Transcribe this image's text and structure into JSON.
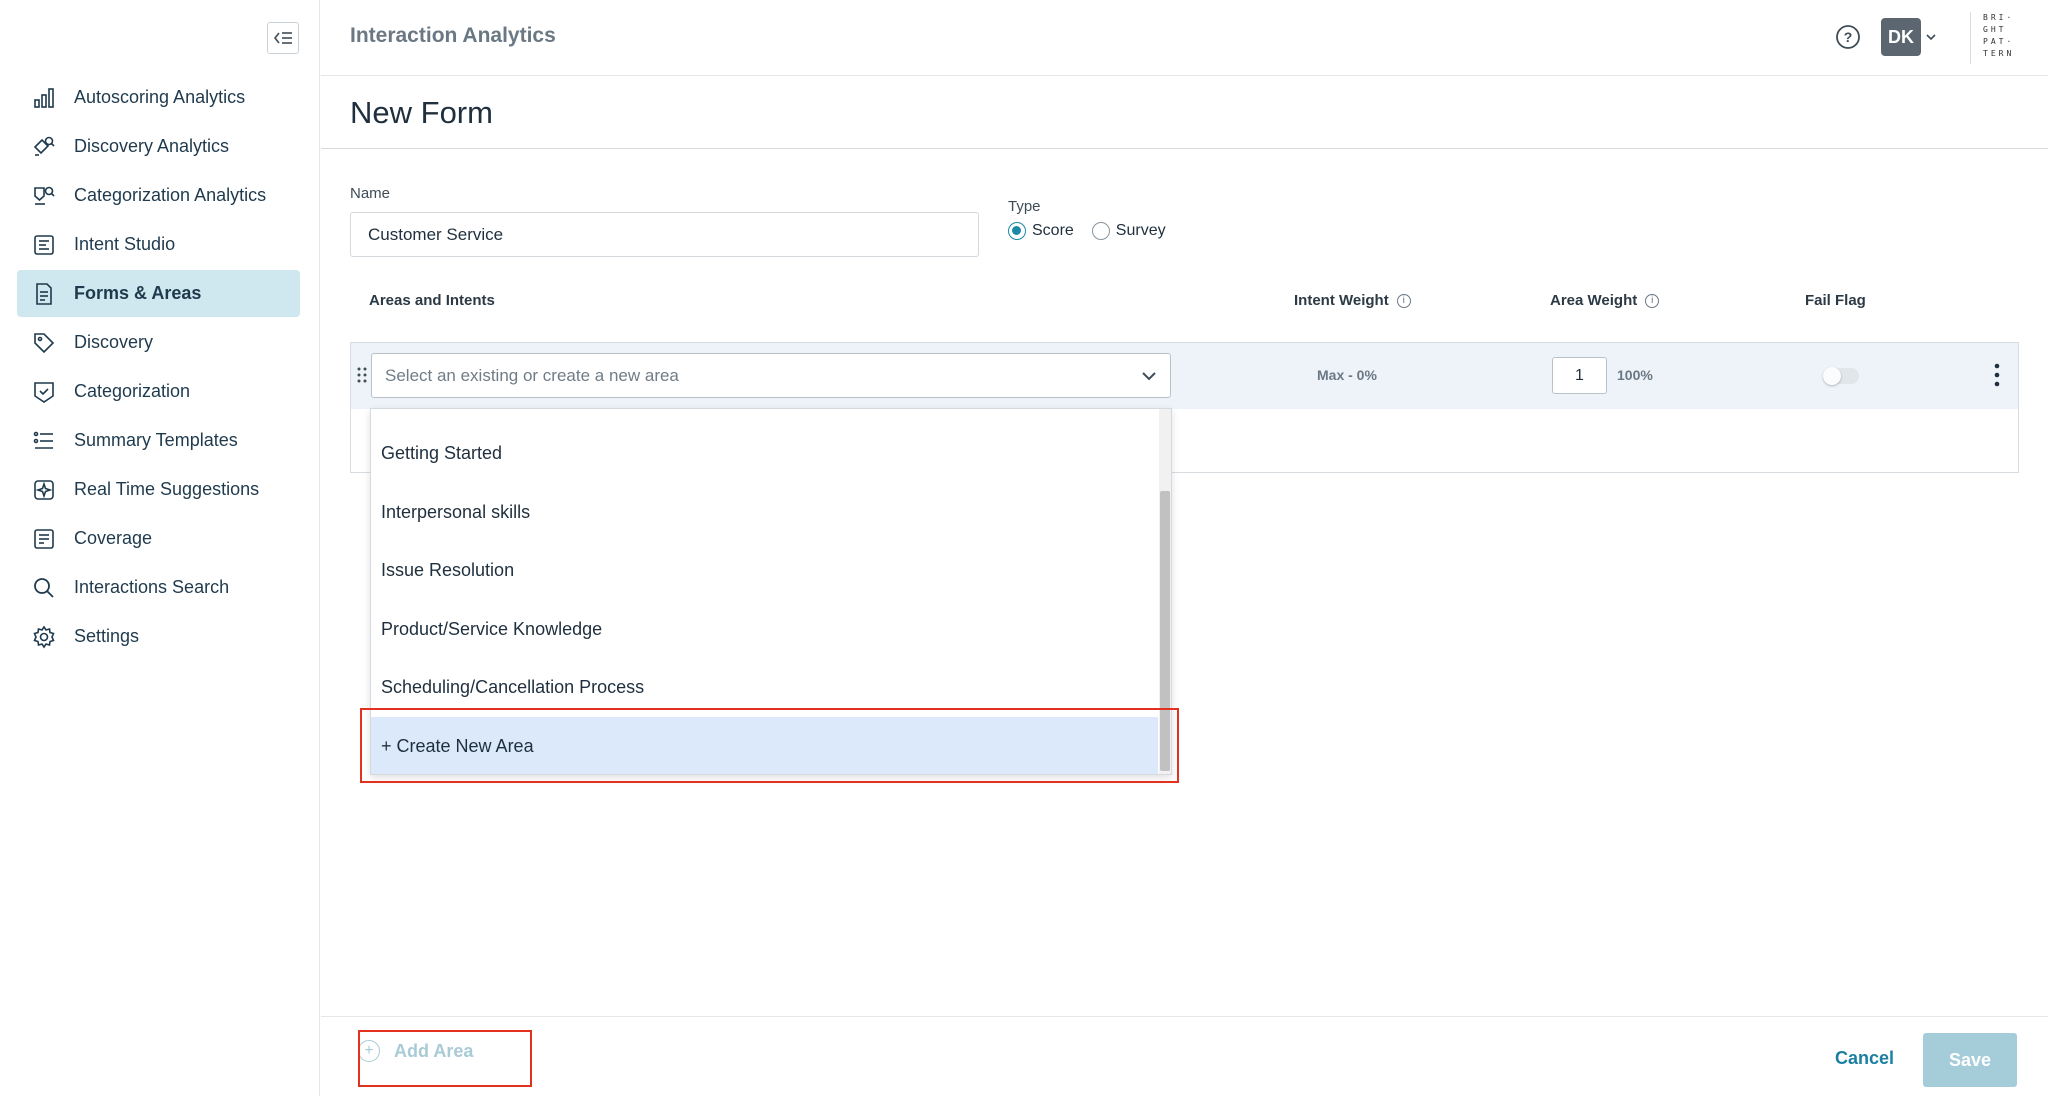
{
  "sidebar": {
    "collapse_icon": "collapse-sidebar-icon",
    "items": [
      {
        "label": "Autoscoring Analytics",
        "icon": "bar-chart-icon",
        "active": false
      },
      {
        "label": "Discovery Analytics",
        "icon": "discovery-analytics-icon",
        "active": false
      },
      {
        "label": "Categorization Analytics",
        "icon": "categorization-analytics-icon",
        "active": false
      },
      {
        "label": "Intent Studio",
        "icon": "intent-studio-icon",
        "active": false
      },
      {
        "label": "Forms & Areas",
        "icon": "document-icon",
        "active": true
      },
      {
        "label": "Discovery",
        "icon": "tag-icon",
        "active": false
      },
      {
        "label": "Categorization",
        "icon": "categorization-icon",
        "active": false
      },
      {
        "label": "Summary Templates",
        "icon": "list-icon",
        "active": false
      },
      {
        "label": "Real Time Suggestions",
        "icon": "sparkle-icon",
        "active": false
      },
      {
        "label": "Coverage",
        "icon": "coverage-icon",
        "active": false
      },
      {
        "label": "Interactions Search",
        "icon": "search-icon",
        "active": false
      },
      {
        "label": "Settings",
        "icon": "gear-icon",
        "active": false
      }
    ]
  },
  "header": {
    "title": "Interaction Analytics",
    "avatar_initials": "DK",
    "logo_lines": [
      "BRI·",
      "GHT",
      "PAT·",
      "TERN"
    ]
  },
  "page": {
    "title": "New Form"
  },
  "form": {
    "name_label": "Name",
    "name_value": "Customer Service",
    "type_label": "Type",
    "type_options": [
      {
        "label": "Score",
        "checked": true
      },
      {
        "label": "Survey",
        "checked": false
      }
    ]
  },
  "table": {
    "col_areas": "Areas and Intents",
    "col_intent_weight": "Intent Weight",
    "col_area_weight": "Area Weight",
    "col_fail_flag": "Fail Flag",
    "row": {
      "select_placeholder": "Select an existing or create a new area",
      "intent_weight": "Max - 0%",
      "area_weight": "1",
      "area_weight_pct": "100%",
      "fail_flag": false
    }
  },
  "dropdown": {
    "options": [
      "Getting Started",
      "Interpersonal skills",
      "Issue Resolution",
      "Product/Service Knowledge",
      "Scheduling/Cancellation Process"
    ],
    "create_label": "+ Create New Area"
  },
  "footer": {
    "add_area_label": "Add Area",
    "cancel_label": "Cancel",
    "save_label": "Save"
  },
  "colors": {
    "accent": "#1a8aa6",
    "active_nav_bg": "#cfe7ee",
    "highlight_box": "#e2321f",
    "save_disabled": "#a5cdd9"
  }
}
